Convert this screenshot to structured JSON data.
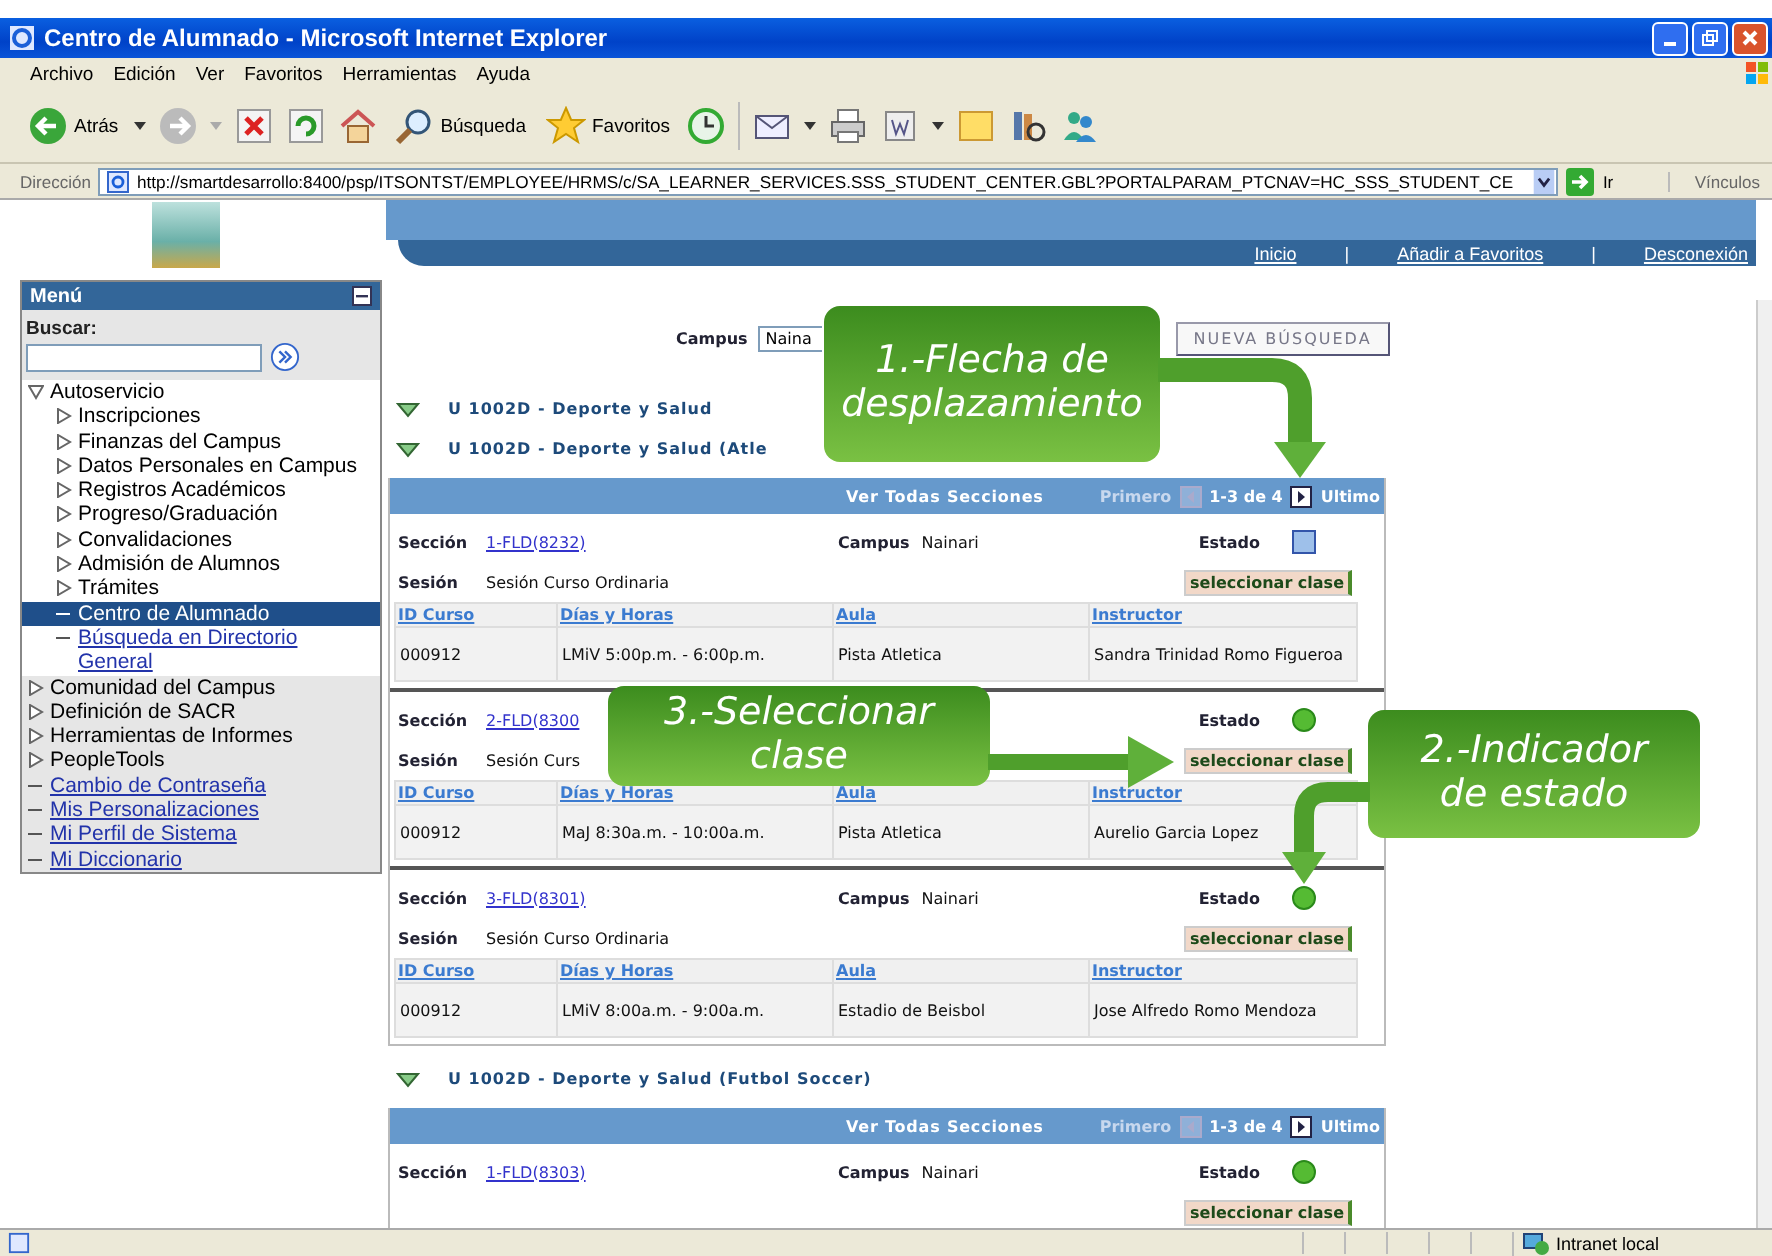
{
  "window": {
    "title": "Centro de Alumnado - Microsoft Internet Explorer"
  },
  "menu_bar": [
    "Archivo",
    "Edición",
    "Ver",
    "Favoritos",
    "Herramientas",
    "Ayuda"
  ],
  "toolbar": {
    "back": "Atrás",
    "search": "Búsqueda",
    "favorites": "Favoritos"
  },
  "address_bar": {
    "label": "Dirección",
    "url": "http://smartdesarrollo:8400/psp/ITSONTST/EMPLOYEE/HRMS/c/SA_LEARNER_SERVICES.SSS_STUDENT_CENTER.GBL?PORTALPARAM_PTCNAV=HC_SSS_STUDENT_CE",
    "go": "Ir",
    "links": "Vínculos"
  },
  "header_links": [
    {
      "kind": "link",
      "text": "Inicio"
    },
    {
      "kind": "separator",
      "text": "|"
    },
    {
      "kind": "link",
      "text": "Añadir a Favoritos"
    },
    {
      "kind": "separator",
      "text": "|"
    },
    {
      "kind": "link",
      "text": "Desconexión"
    }
  ],
  "sidebar": {
    "title": "Menú",
    "search_label": "Buscar:",
    "items": [
      {
        "kind": "folder",
        "label": "Autoservicio",
        "expanded": true,
        "selected": false,
        "children": [
          {
            "kind": "folder",
            "label": "Inscripciones",
            "expanded": false,
            "selected": false
          },
          {
            "kind": "folder",
            "label": "Finanzas del Campus",
            "expanded": false,
            "selected": false
          },
          {
            "kind": "folder",
            "label": "Datos Personales en Campus",
            "expanded": false,
            "selected": false
          },
          {
            "kind": "folder",
            "label": "Registros Académicos",
            "expanded": false,
            "selected": false
          },
          {
            "kind": "folder",
            "label": "Progreso/Graduación",
            "expanded": false,
            "selected": false
          },
          {
            "kind": "folder",
            "label": "Convalidaciones",
            "expanded": false,
            "selected": false
          },
          {
            "kind": "folder",
            "label": "Admisión de Alumnos",
            "expanded": false,
            "selected": false
          },
          {
            "kind": "folder",
            "label": "Trámites",
            "expanded": false,
            "selected": false
          },
          {
            "kind": "link",
            "label": "Centro de Alumnado",
            "selected": true
          },
          {
            "kind": "link",
            "label": "Búsqueda en Directorio General",
            "selected": false
          }
        ]
      },
      {
        "kind": "folder",
        "label": "Comunidad del Campus",
        "expanded": false,
        "selected": false
      },
      {
        "kind": "folder",
        "label": "Definición de SACR",
        "expanded": false,
        "selected": false
      },
      {
        "kind": "folder",
        "label": "Herramientas de Informes",
        "expanded": false,
        "selected": false
      },
      {
        "kind": "folder",
        "label": "PeopleTools",
        "expanded": false,
        "selected": false
      },
      {
        "kind": "link",
        "label": "Cambio de Contraseña",
        "selected": false
      },
      {
        "kind": "link",
        "label": "Mis Personalizaciones",
        "selected": false
      },
      {
        "kind": "link",
        "label": "Mi Perfil de Sistema",
        "selected": false
      },
      {
        "kind": "link",
        "label": "Mi Diccionario",
        "selected": false
      }
    ]
  },
  "search_bar": {
    "label": "Campus",
    "value": "Naina",
    "buttons": [
      "NUEVA BÚSQUEDA"
    ]
  },
  "course_groups": [
    {
      "title": "U 1002D - Deporte y Salud",
      "expanded": true
    },
    {
      "title": "U 1002D - Deporte y Salud (Atle",
      "expanded": true,
      "grid": {
        "view_all": "Ver Todas Secciones",
        "first": "Primero",
        "range": "1-3 de 4",
        "last": "Ultimo"
      },
      "sections": [
        {
          "section_label": "Sección",
          "section": "1-FLD(8232)",
          "campus_label": "Campus",
          "campus": "Nainari",
          "status_label": "Estado",
          "open": false,
          "session_label": "Sesión",
          "session": "Sesión Curso Ordinaria",
          "button": "seleccionar clase",
          "columns": [
            "ID Curso",
            "Días y Horas",
            "Aula",
            "Instructor"
          ],
          "row": [
            "000912",
            "LMiV 5:00p.m. - 6:00p.m.",
            "Pista Atletica",
            "Sandra Trinidad Romo Figueroa"
          ]
        },
        {
          "section_label": "Sección",
          "section": "2-FLD(8300",
          "status_label": "Estado",
          "open": true,
          "session_label": "Sesión",
          "session": "Sesión Curs",
          "button": "seleccionar clase",
          "columns": [
            "ID Curso",
            "Días y Horas",
            "Aula",
            "Instructor"
          ],
          "row": [
            "000912",
            "MaJ 8:30a.m. - 10:00a.m.",
            "Pista Atletica",
            "Aurelio Garcia Lopez"
          ]
        },
        {
          "section_label": "Sección",
          "section": "3-FLD(8301)",
          "campus_label": "Campus",
          "campus": "Nainari",
          "status_label": "Estado",
          "open": true,
          "session_label": "Sesión",
          "session": "Sesión Curso Ordinaria",
          "button": "seleccionar clase",
          "columns": [
            "ID Curso",
            "Días y Horas",
            "Aula",
            "Instructor"
          ],
          "row": [
            "000912",
            "LMiV 8:00a.m. - 9:00a.m.",
            "Estadio de Beisbol",
            "Jose Alfredo Romo Mendoza"
          ]
        }
      ]
    },
    {
      "title": "U 1002D - Deporte y Salud (Futbol Soccer)",
      "expanded": true,
      "grid": {
        "view_all": "Ver Todas Secciones",
        "first": "Primero",
        "range": "1-3 de 4",
        "last": "Ultimo"
      },
      "sections": [
        {
          "section_label": "Sección",
          "section": "1-FLD(8303)",
          "campus_label": "Campus",
          "campus": "Nainari",
          "status_label": "Estado",
          "open": true,
          "button": "seleccionar clase"
        }
      ]
    }
  ],
  "callouts": [
    {
      "text": "1.-Flecha de desplazamiento"
    },
    {
      "text": "3.-Seleccionar clase"
    },
    {
      "text": "2.-Indicador de estado"
    }
  ],
  "status_bar": {
    "zone": "Intranet local"
  }
}
